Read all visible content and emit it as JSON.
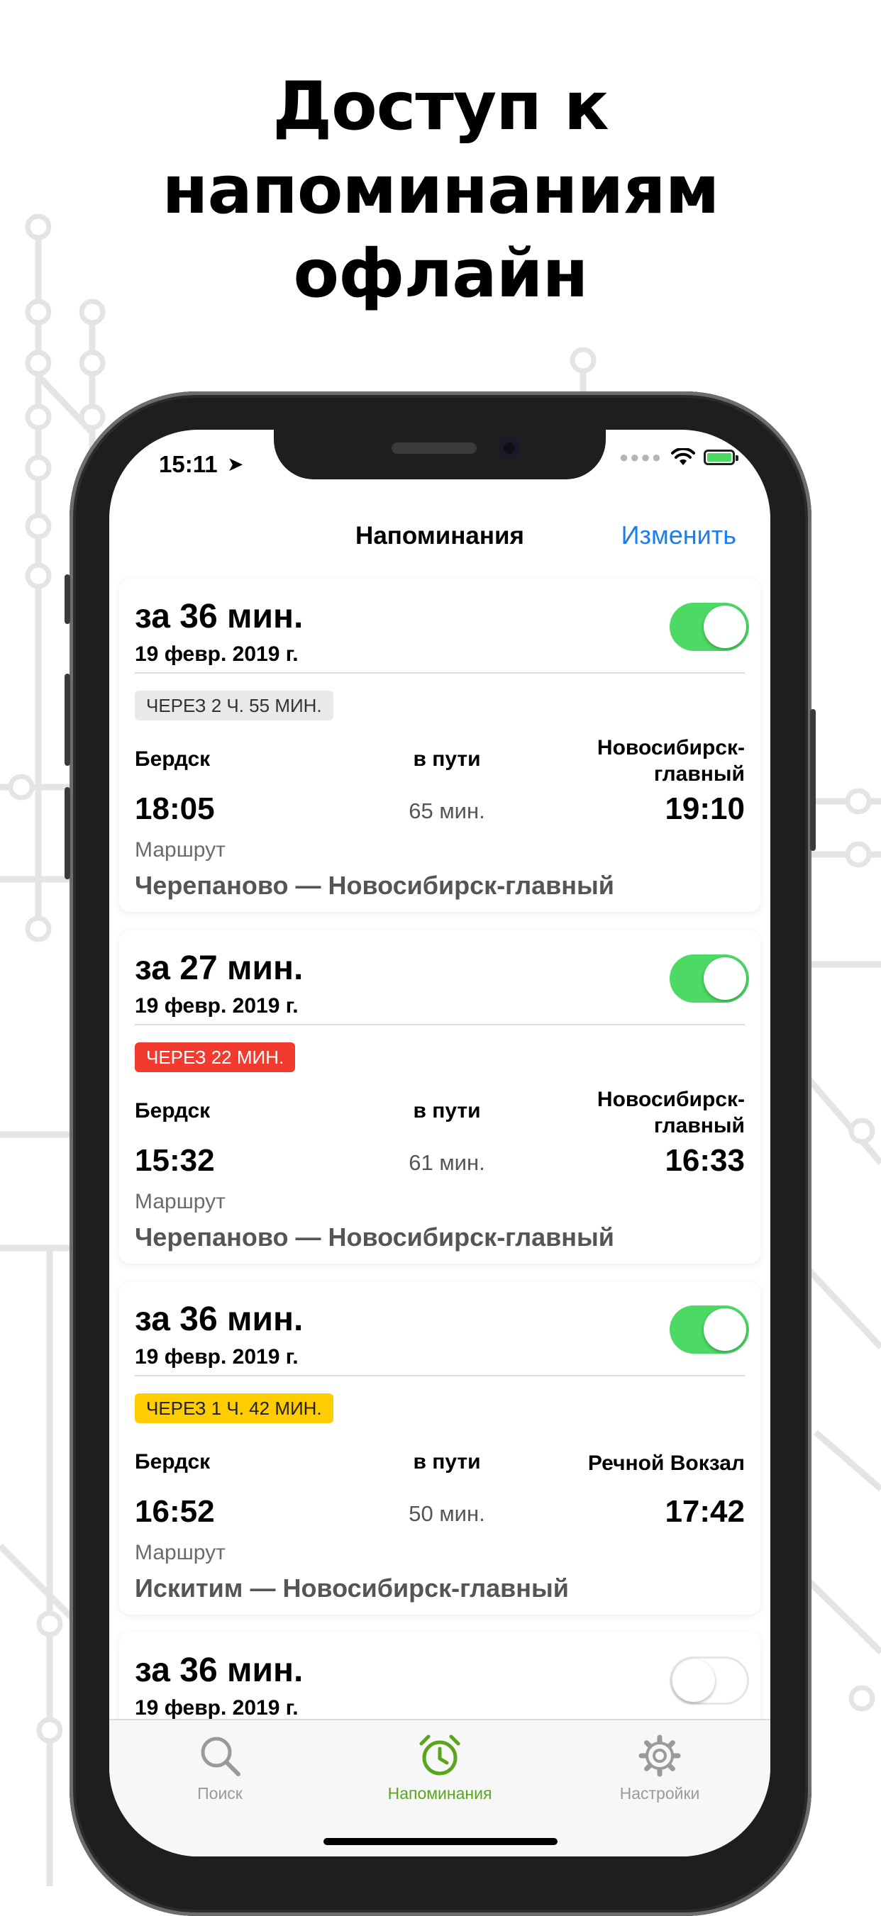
{
  "headline": {
    "line1": "Доступ к",
    "line2": "напоминаниям",
    "line3": "офлайн"
  },
  "status_bar": {
    "time": "15:11",
    "location_glyph": "➤"
  },
  "nav": {
    "title": "Напоминания",
    "edit_label": "Изменить"
  },
  "reminders": [
    {
      "title": "за 36 мин.",
      "date": "19 февр. 2019 г.",
      "enabled": true,
      "badge": {
        "text": "ЧЕРЕЗ 2 Ч. 55 МИН.",
        "bg": "#e9e9e9",
        "fg": "#333333"
      },
      "from": "Бердск",
      "mid_label": "в пути",
      "to": "Новосибирск-главный",
      "departure": "18:05",
      "duration": "65 мин.",
      "arrival": "19:10",
      "route_label": "Маршрут",
      "route": "Черепаново — Новосибирск-главный"
    },
    {
      "title": "за 27 мин.",
      "date": "19 февр. 2019 г.",
      "enabled": true,
      "badge": {
        "text": "ЧЕРЕЗ 22 МИН.",
        "bg": "#f23a2f",
        "fg": "#ffffff"
      },
      "from": "Бердск",
      "mid_label": "в пути",
      "to": "Новосибирск-главный",
      "departure": "15:32",
      "duration": "61 мин.",
      "arrival": "16:33",
      "route_label": "Маршрут",
      "route": "Черепаново — Новосибирск-главный"
    },
    {
      "title": "за 36 мин.",
      "date": "19 февр. 2019 г.",
      "enabled": true,
      "badge": {
        "text": "ЧЕРЕЗ 1 Ч. 42 МИН.",
        "bg": "#ffcc00",
        "fg": "#222222"
      },
      "from": "Бердск",
      "mid_label": "в пути",
      "to": "Речной Вокзал",
      "departure": "16:52",
      "duration": "50 мин.",
      "arrival": "17:42",
      "route_label": "Маршрут",
      "route": "Искитим — Новосибирск-главный"
    },
    {
      "title": "за 36 мин.",
      "date": "19 февр. 2019 г.",
      "enabled": false
    }
  ],
  "tabbar": {
    "items": [
      {
        "label": "Поиск",
        "icon": "search-icon",
        "active": false
      },
      {
        "label": "Напоминания",
        "icon": "alarm-clock-icon",
        "active": true
      },
      {
        "label": "Настройки",
        "icon": "gear-icon",
        "active": false
      }
    ],
    "active_color": "#59a61e",
    "inactive_color": "#9a9a9a"
  },
  "colors": {
    "toggle_on": "#4cd964",
    "link": "#1a7df0"
  }
}
